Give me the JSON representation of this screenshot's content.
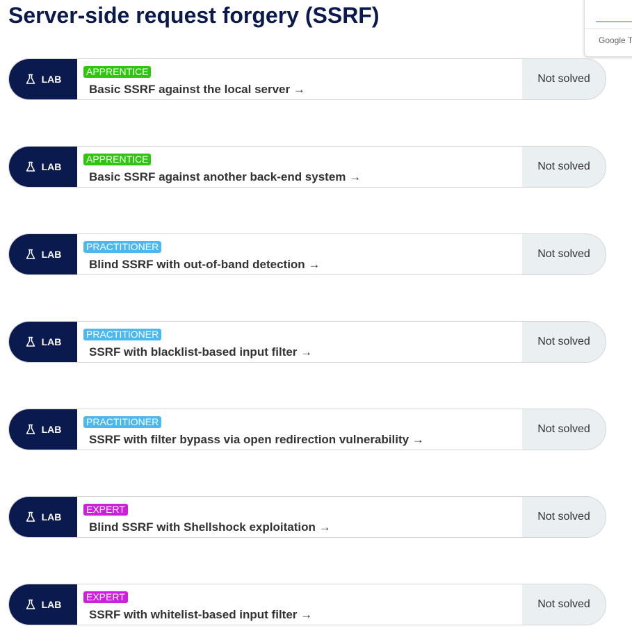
{
  "page": {
    "title": "Server-side request forgery (SSRF)"
  },
  "translate_widget": {
    "label": "Google T"
  },
  "colors": {
    "navy": "#0a1a4f",
    "apprentice": "#2fc60e",
    "practitioner": "#4cb8f0",
    "expert": "#cf1fde",
    "status_bg": "#eaeff2"
  },
  "labs": [
    {
      "tag": "LAB",
      "icon": "flask-icon",
      "level": "APPRENTICE",
      "level_color": "#2fc60e",
      "title": "Basic SSRF against the local server →",
      "status": "Not solved"
    },
    {
      "tag": "LAB",
      "icon": "flask-icon",
      "level": "APPRENTICE",
      "level_color": "#2fc60e",
      "title": "Basic SSRF against another back-end system →",
      "status": "Not solved"
    },
    {
      "tag": "LAB",
      "icon": "flask-icon",
      "level": "PRACTITIONER",
      "level_color": "#4cb8f0",
      "title": "Blind SSRF with out-of-band detection →",
      "status": "Not solved"
    },
    {
      "tag": "LAB",
      "icon": "flask-icon",
      "level": "PRACTITIONER",
      "level_color": "#4cb8f0",
      "title": "SSRF with blacklist-based input filter →",
      "status": "Not solved"
    },
    {
      "tag": "LAB",
      "icon": "flask-icon",
      "level": "PRACTITIONER",
      "level_color": "#4cb8f0",
      "title": "SSRF with filter bypass via open redirection vulnerability →",
      "status": "Not solved"
    },
    {
      "tag": "LAB",
      "icon": "flask-icon",
      "level": "EXPERT",
      "level_color": "#cf1fde",
      "title": "Blind SSRF with Shellshock exploitation →",
      "status": "Not solved"
    },
    {
      "tag": "LAB",
      "icon": "flask-icon",
      "level": "EXPERT",
      "level_color": "#cf1fde",
      "title": "SSRF with whitelist-based input filter →",
      "status": "Not solved"
    }
  ]
}
